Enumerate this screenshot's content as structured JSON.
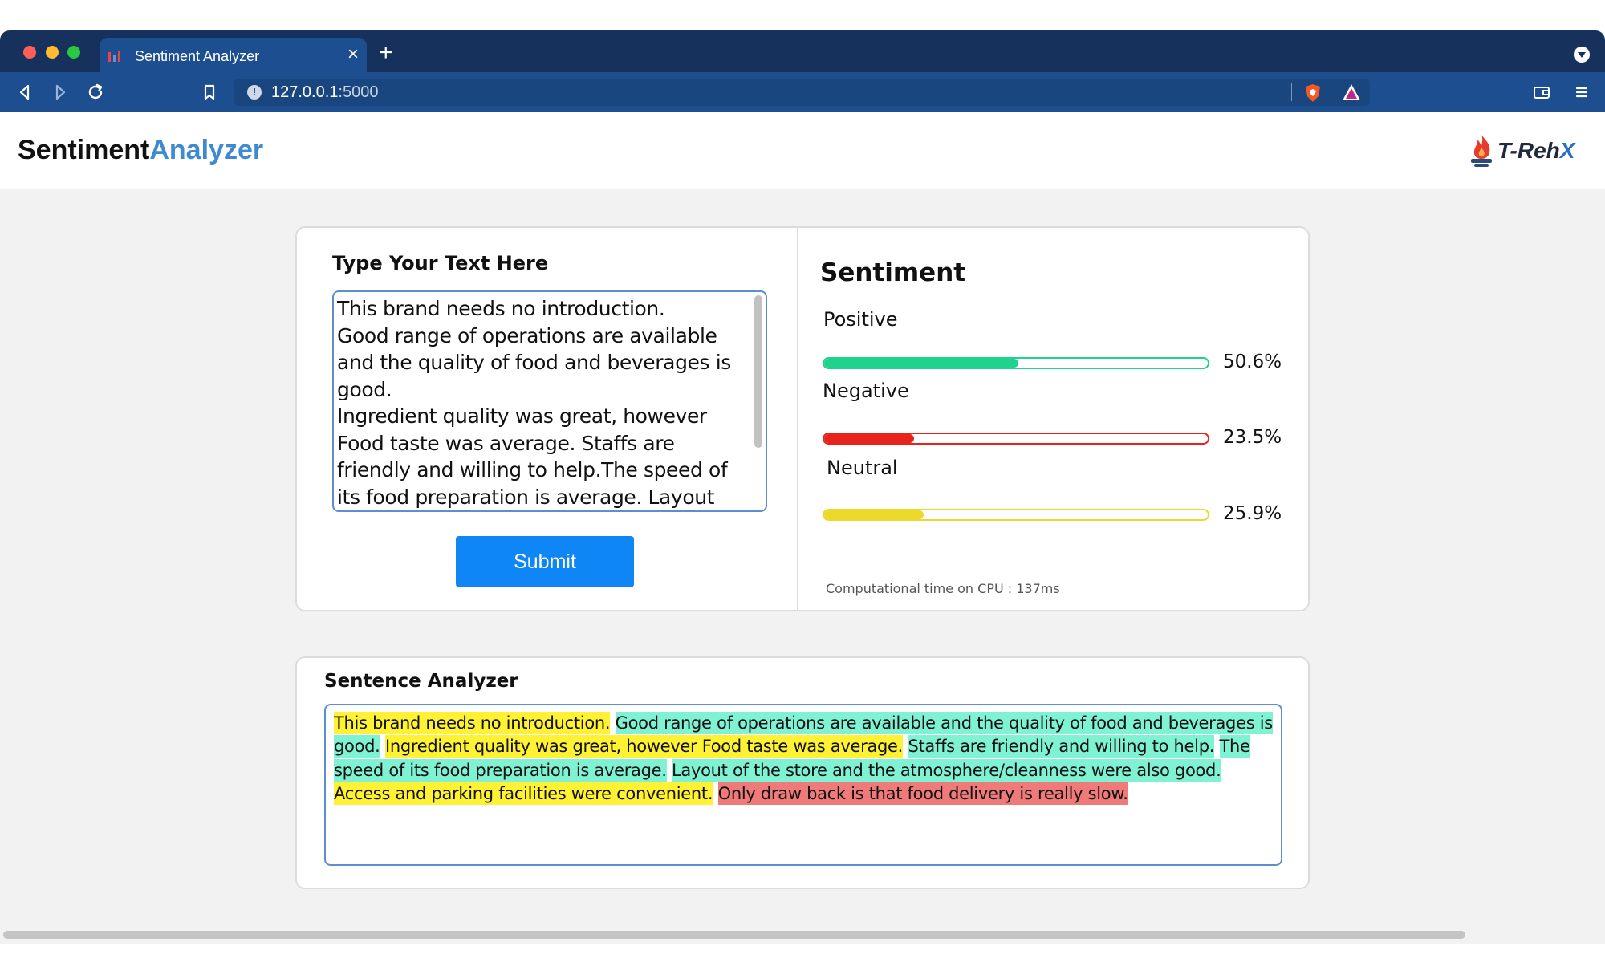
{
  "browser": {
    "tab_title": "Sentiment Analyzer",
    "tab_close": "×",
    "new_tab": "+",
    "url_host": "127.0.0.1",
    "url_port": ":5000"
  },
  "header": {
    "brand_part1": "Sentiment",
    "brand_part2": "Analyzer",
    "logo_text_main": "T-Reh",
    "logo_text_x": "X",
    "accent_color": "#3d8ad0"
  },
  "input_panel": {
    "heading": "Type Your Text Here",
    "text_value": "This brand needs no introduction.\nGood range of operations are available and the quality of food and beverages is good.\nIngredient quality was great, however Food taste was average. Staffs are friendly and willing to help.The speed of its food preparation is average. Layout of the store and the atmosphere/cleanness were also",
    "submit_label": "Submit",
    "submit_color": "#0f86f5"
  },
  "sentiment_panel": {
    "heading": "Sentiment",
    "items": [
      {
        "label": "Positive",
        "percent_text": "50.6%",
        "fraction": 0.506,
        "color": "#1fd38e"
      },
      {
        "label": "Negative",
        "percent_text": "23.5%",
        "fraction": 0.235,
        "color": "#e8231c"
      },
      {
        "label": "Neutral",
        "percent_text": "25.9%",
        "fraction": 0.259,
        "color": "#ecd92a"
      }
    ],
    "comp_time": "Computational time on CPU : 137ms"
  },
  "sentence_analyzer": {
    "heading": "Sentence Analyzer",
    "sentences": [
      {
        "text": "This brand needs no introduction.",
        "sentiment": "neutral"
      },
      {
        "text": "Good range of operations are available and the quality of food and beverages is good.",
        "sentiment": "positive"
      },
      {
        "text": "Ingredient quality was great, however Food taste was average.",
        "sentiment": "neutral"
      },
      {
        "text": "Staffs are friendly and willing to help.",
        "sentiment": "positive"
      },
      {
        "text": "The speed of its food preparation is average.",
        "sentiment": "positive"
      },
      {
        "text": "Layout of the store and the atmosphere/cleanness were also good.",
        "sentiment": "positive"
      },
      {
        "text": "Access and parking facilities were convenient.",
        "sentiment": "neutral"
      },
      {
        "text": "Only draw back is that food delivery is really slow.",
        "sentiment": "negative"
      }
    ],
    "colors": {
      "neutral": "#fff134",
      "positive": "#7ef2d3",
      "negative": "#ee7a79"
    }
  }
}
